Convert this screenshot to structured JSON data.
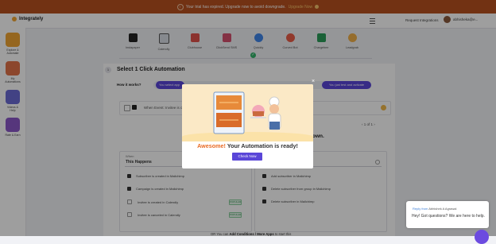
{
  "banner": {
    "text": "Your trial has expired. Upgrade now to avoid downgrade.",
    "link": "Upgrade Now",
    "warn_icon": "!"
  },
  "topbar": {
    "logo": "Integrately",
    "request": "Request Integrations",
    "user": "abhisheka@e..."
  },
  "sidebar": {
    "items": [
      {
        "label": "Explore & Automate",
        "color": "#f1a533"
      },
      {
        "label": "My Automations",
        "color": "#e2734a"
      },
      {
        "label": "Videos & Help",
        "color": "#6b6bd6"
      },
      {
        "label": "Rate & Earn",
        "color": "#8b58c9"
      }
    ]
  },
  "apps": [
    {
      "name": "Instapaper",
      "color": "#222222"
    },
    {
      "name": "Calendly",
      "color": "#d9dde6"
    },
    {
      "name": "Clubhouse",
      "color": "#e0524b"
    },
    {
      "name": "ClickSend SMS",
      "color": "#d5506e"
    },
    {
      "name": "Quickly",
      "color": "#3f86ea"
    },
    {
      "name": "Curved Bot",
      "color": "#ea5d48"
    },
    {
      "name": "Chargebee",
      "color": "#2a9d5a"
    },
    {
      "name": "Leadgrab",
      "color": "#f1b14a"
    }
  ],
  "main": {
    "step": "1",
    "title": "Select 1 Click Automation",
    "how_label": "How it works?",
    "tab_active": "You select app",
    "tab_right": "You just test and activate",
    "when_text": "When Event: Invitee is created",
    "pager": "1 of 1",
    "wn_heading": "own.",
    "left_col": {
      "header": "When",
      "sub": "This Happens",
      "options": [
        {
          "icon": "notion-icon",
          "label": "Subscriber is created in Mailchimp",
          "badge": ""
        },
        {
          "icon": "notion-icon",
          "label": "Campaign is created in Mailchimp",
          "badge": ""
        },
        {
          "icon": "calendar-icon",
          "label": "Invitee is created in Calendly",
          "badge": "POPULAR"
        },
        {
          "icon": "calendar-icon",
          "label": "Invitee is canceled in Calendly",
          "badge": "POPULAR"
        }
      ]
    },
    "right_col": {
      "options": [
        {
          "label": "Add subscriber in Mailchimp"
        },
        {
          "label": "Delete subscriber from group in Mailchimp"
        },
        {
          "label": "Delete subscriber in Mailchimp"
        }
      ]
    },
    "footer_pre": "OR You can",
    "footer_bold": "Add Conditions / More Apps",
    "footer_post": "to start this"
  },
  "modal": {
    "accent": "Awesome!",
    "message": "Your Automation is ready!",
    "button": "Check Now",
    "close": "×"
  },
  "chat": {
    "reply_from": "Reply from",
    "agent": "Abhishek A Agrawal",
    "text": "Hey! Got questions? We are here to help."
  }
}
